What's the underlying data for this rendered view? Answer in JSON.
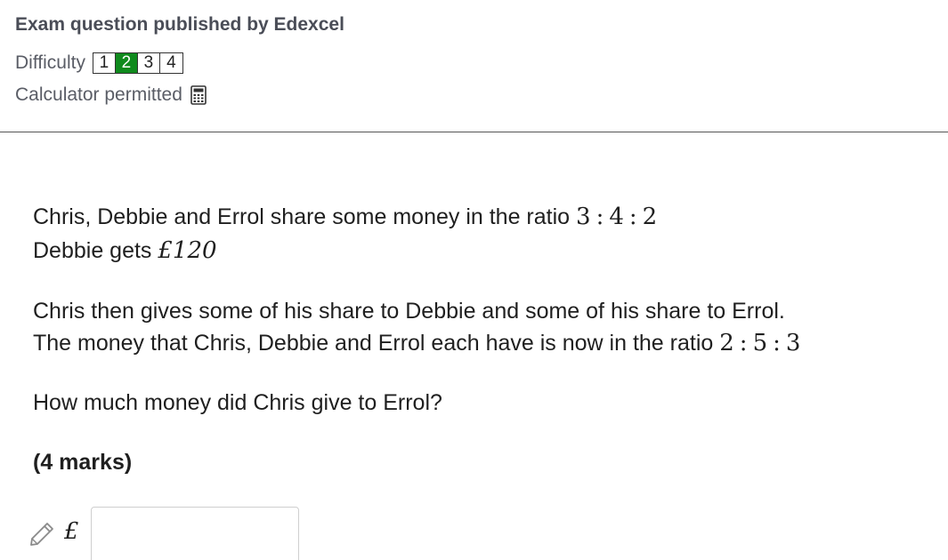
{
  "header": {
    "title": "Exam question published by Edexcel",
    "difficulty_label": "Difficulty",
    "difficulty_levels": [
      "1",
      "2",
      "3",
      "4"
    ],
    "difficulty_selected": "2",
    "calculator_label": "Calculator permitted",
    "calculator_icon": "calculator-icon"
  },
  "question": {
    "line1_text": "Chris, Debbie and Errol share some money in the ratio",
    "line1_ratio": [
      "3",
      "4",
      "2"
    ],
    "line2_text": "Debbie gets",
    "line2_amount": "£120",
    "line3_text": "Chris then gives some of his share to Debbie and some of his share to Errol.",
    "line4_text": "The money that Chris, Debbie and Errol each have is now in the ratio",
    "line4_ratio": [
      "2",
      "5",
      "3"
    ],
    "line5_text": "How much money did Chris give to Errol?",
    "marks": "(4 marks)"
  },
  "answer": {
    "currency": "£",
    "value": "",
    "pencil_icon": "pencil-icon"
  },
  "colors": {
    "difficulty_active": "#0f8a1d",
    "header_text": "#4a4d57"
  }
}
